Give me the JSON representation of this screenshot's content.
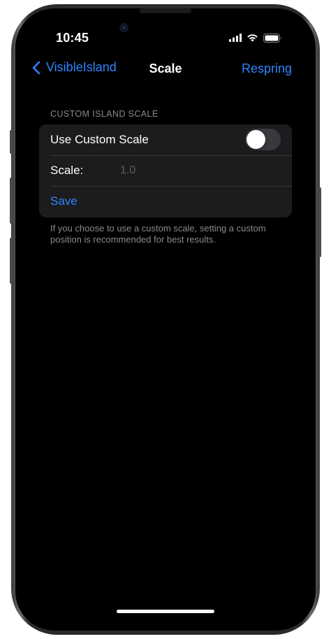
{
  "status_bar": {
    "time": "10:45",
    "icons": [
      "cellular-signal-icon",
      "wifi-icon",
      "battery-icon"
    ]
  },
  "nav": {
    "back_label": "VisibleIsland",
    "title": "Scale",
    "right_action": "Respring"
  },
  "section": {
    "header": "CUSTOM ISLAND SCALE",
    "rows": {
      "use_custom": {
        "label": "Use Custom Scale",
        "toggle_on": false
      },
      "scale": {
        "label": "Scale:",
        "value": "",
        "placeholder": "1.0"
      },
      "save": {
        "label": "Save"
      }
    },
    "footer": "If you choose to use a custom scale, setting a custom position is recommended for best results."
  },
  "colors": {
    "accent": "#2f84ff",
    "background": "#000000",
    "group_background": "#1c1c1e",
    "secondary_text": "#8a8a8e"
  }
}
